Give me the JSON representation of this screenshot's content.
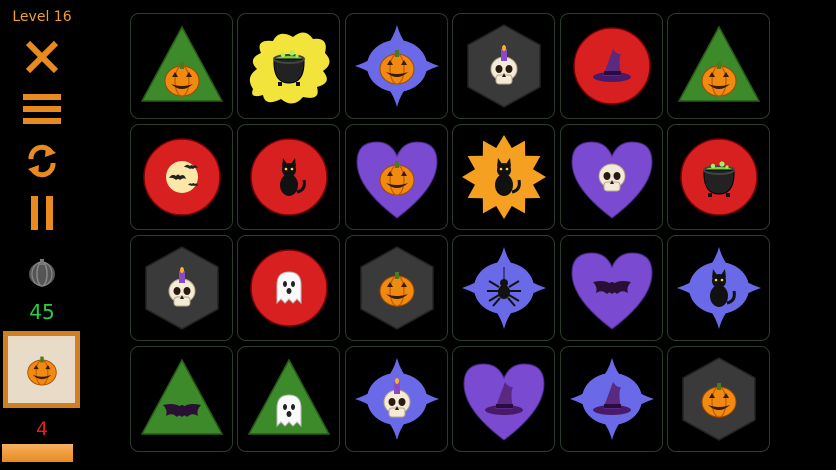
{
  "sidebar": {
    "level_label": "Level 16",
    "buttons": [
      {
        "name": "close-button",
        "icon": "close-icon"
      },
      {
        "name": "menu-button",
        "icon": "menu-icon"
      },
      {
        "name": "restart-button",
        "icon": "restart-icon"
      },
      {
        "name": "pause-button",
        "icon": "pause-icon"
      }
    ],
    "pumpkin_counter": "45",
    "moves_counter": "4",
    "target_symbol": "pumpkin",
    "progress_fraction": 1.0
  },
  "colors": {
    "accent": "#e88a20",
    "counter_green": "#2ecc40",
    "counter_red": "#e02020"
  },
  "board": {
    "rows": 4,
    "cols": 6,
    "tiles": [
      {
        "shape": "triangle",
        "color": "green",
        "symbol": "pumpkin"
      },
      {
        "shape": "splash",
        "color": "yellow",
        "symbol": "cauldron"
      },
      {
        "shape": "star4",
        "color": "blue",
        "symbol": "pumpkin"
      },
      {
        "shape": "hexagon",
        "color": "gray",
        "symbol": "skull-candle"
      },
      {
        "shape": "circle",
        "color": "red",
        "symbol": "witch-hat"
      },
      {
        "shape": "triangle",
        "color": "green",
        "symbol": "pumpkin"
      },
      {
        "shape": "circle",
        "color": "red",
        "symbol": "moon-bats"
      },
      {
        "shape": "circle",
        "color": "red",
        "symbol": "cat"
      },
      {
        "shape": "heart",
        "color": "purple",
        "symbol": "pumpkin"
      },
      {
        "shape": "starburst",
        "color": "orange",
        "symbol": "cat"
      },
      {
        "shape": "heart",
        "color": "purple",
        "symbol": "skull"
      },
      {
        "shape": "circle",
        "color": "red",
        "symbol": "cauldron"
      },
      {
        "shape": "hexagon",
        "color": "gray",
        "symbol": "skull-candle"
      },
      {
        "shape": "circle",
        "color": "red",
        "symbol": "ghost"
      },
      {
        "shape": "hexagon",
        "color": "gray",
        "symbol": "pumpkin"
      },
      {
        "shape": "star4",
        "color": "blue",
        "symbol": "spider"
      },
      {
        "shape": "heart",
        "color": "purple",
        "symbol": "bat"
      },
      {
        "shape": "star4",
        "color": "blue",
        "symbol": "cat"
      },
      {
        "shape": "triangle",
        "color": "green",
        "symbol": "bat"
      },
      {
        "shape": "triangle",
        "color": "green",
        "symbol": "ghost"
      },
      {
        "shape": "star4",
        "color": "blue",
        "symbol": "skull-candle"
      },
      {
        "shape": "heart",
        "color": "purple",
        "symbol": "witch-hat"
      },
      {
        "shape": "star4",
        "color": "blue",
        "symbol": "witch-hat"
      },
      {
        "shape": "hexagon",
        "color": "gray",
        "symbol": "pumpkin"
      }
    ]
  }
}
